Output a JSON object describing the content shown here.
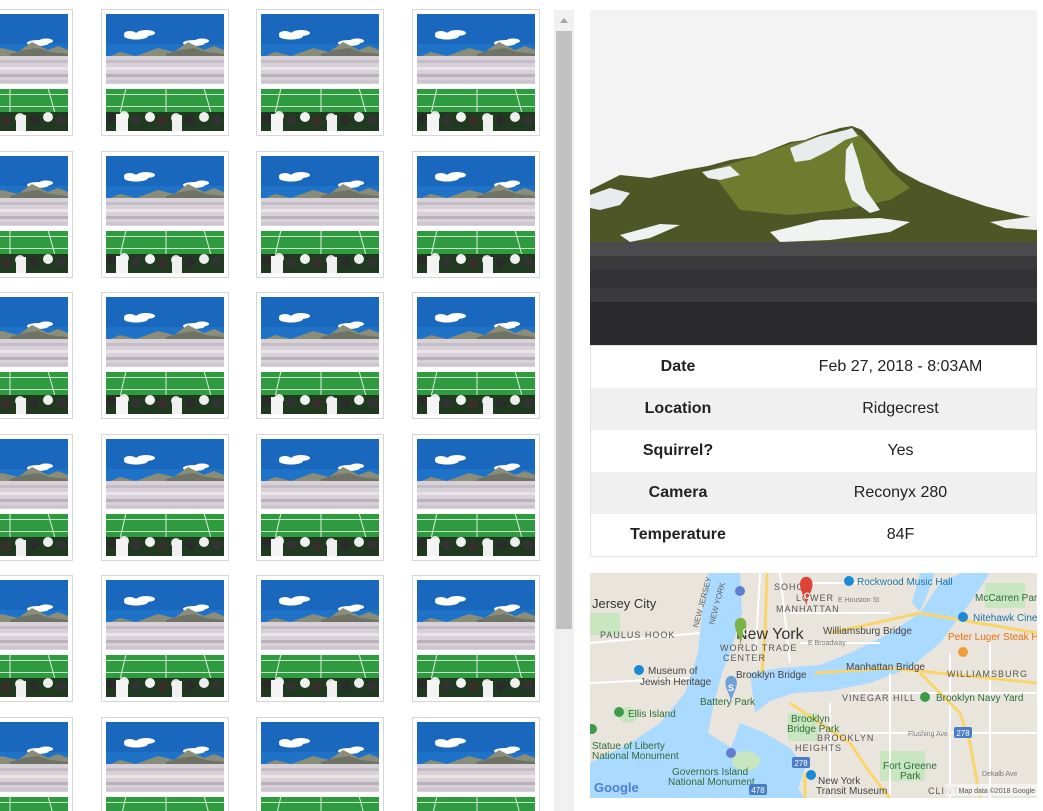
{
  "thumbnail_grid": {
    "image_subject": "stadium-crowd-photo",
    "columns": 4,
    "rows": 6
  },
  "detail": {
    "image_subject": "green-mountain-with-snow-photo",
    "rows": [
      {
        "label": "Date",
        "value": "Feb 27, 2018 - 8:03AM"
      },
      {
        "label": "Location",
        "value": "Ridgecrest"
      },
      {
        "label": "Squirrel?",
        "value": "Yes"
      },
      {
        "label": "Camera",
        "value": "Reconyx 280"
      },
      {
        "label": "Temperature",
        "value": "84F"
      }
    ]
  },
  "map": {
    "place_labels": {
      "jersey_city": "Jersey City",
      "paulus_hook": "PAULUS HOOK",
      "new_jersey": "NEW JERSEY",
      "new_york_state": "NEW YORK",
      "new_york": "New York",
      "world_trade": "WORLD TRADE",
      "center": "CENTER",
      "soho": "SOHO",
      "lower": "LOWER",
      "manhattan": "MANHATTAN",
      "rockwood": "Rockwood Music Hall",
      "mccarren": "McCarren Park",
      "nitehawk": "Nitehawk Cine",
      "williamsburg_bridge": "Williamsburg Bridge",
      "peter_luger": "Peter Luger Steak Ho",
      "williamsburg": "WILLIAMSBURG",
      "museum_of": "Museum of",
      "jewish_heritage": "Jewish Heritage",
      "brooklyn_bridge": "Brooklyn Bridge",
      "manhattan_bridge": "Manhattan Bridge",
      "battery_park": "Battery Park",
      "vinegar_hill": "VINEGAR HILL",
      "brooklyn_navy_yard": "Brooklyn Navy Yard",
      "ellis_island": "Ellis Island",
      "brooklyn_bridge_park_1": "Brooklyn",
      "brooklyn_bridge_park_2": "Bridge Park",
      "brooklyn_heights": "HEIGHTS",
      "brooklyn": "BROOKLYN",
      "statue_1": "Statue of Liberty",
      "statue_2": "National Monument",
      "governors_1": "Governors Island",
      "governors_2": "National Monument",
      "fort_greene_1": "Fort Greene",
      "fort_greene_2": "Park",
      "new_york_transit_1": "New York",
      "new_york_transit_2": "Transit Museum",
      "clinton": "CLINTO",
      "flushing_ave": "Flushing Ave",
      "dekalb": "Dekalb Ave",
      "e_broadway": "E Broadway",
      "e_houston": "E Houston St",
      "google": "Google",
      "attribution": "Map data ©2018 Google"
    },
    "highway_shields": [
      "278",
      "278",
      "478"
    ],
    "markers": [
      {
        "letter": "C",
        "color": "#db4437"
      },
      {
        "letter": "G",
        "color": "#7cb342"
      },
      {
        "letter": "S",
        "color": "#6fa0dc"
      }
    ]
  }
}
